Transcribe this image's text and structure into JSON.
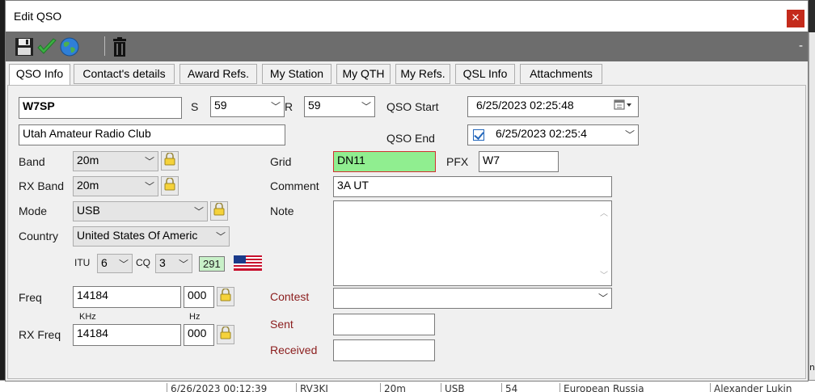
{
  "window": {
    "title": "Edit QSO",
    "close_glyph": "✕"
  },
  "toolbar": {
    "icons": [
      "save-icon",
      "checkmark-icon",
      "globe-icon",
      "trash-icon"
    ],
    "collapse_glyph": "-"
  },
  "tabs": [
    {
      "label": "QSO Info",
      "active": true
    },
    {
      "label": "Contact's details"
    },
    {
      "label": "Award Refs."
    },
    {
      "label": "My Station"
    },
    {
      "label": "My QTH"
    },
    {
      "label": "My Refs."
    },
    {
      "label": "QSL Info"
    },
    {
      "label": "Attachments"
    }
  ],
  "qso": {
    "callsign": "W7SP",
    "s_label": "S",
    "s_value": "59",
    "r_label": "R",
    "r_value": "59",
    "name": "Utah Amateur Radio Club",
    "start_label": "QSO Start",
    "start_value": "6/25/2023 02:25:48",
    "end_label": "QSO End",
    "end_value": "6/25/2023 02:25:4",
    "band_label": "Band",
    "band_value": "20m",
    "rxband_label": "RX Band",
    "rxband_value": "20m",
    "mode_label": "Mode",
    "mode_value": "USB",
    "country_label": "Country",
    "country_value": "United States Of Americ",
    "itu_label": "ITU",
    "itu_value": "6",
    "cq_label": "CQ",
    "cq_value": "3",
    "dxcc_code": "291",
    "grid_label": "Grid",
    "grid_value": "DN11",
    "pfx_label": "PFX",
    "pfx_value": "W7",
    "comment_label": "Comment",
    "comment_value": "3A UT",
    "note_label": "Note",
    "note_value": "",
    "freq_label": "Freq",
    "freq_value": "14184",
    "freq_hz": "000",
    "khz_label": "KHz",
    "hz_label": "Hz",
    "rxfreq_label": "RX Freq",
    "rxfreq_value": "14184",
    "rxfreq_hz": "000",
    "contest_label": "Contest",
    "contest_value": "",
    "sent_label": "Sent",
    "sent_value": "",
    "received_label": "Received",
    "received_value": ""
  },
  "background": {
    "log_row": [
      "6/26/2023 00:12:39",
      "RV3KJ",
      "20m",
      "USB",
      "54",
      "European Russia",
      "Alexander Lukin"
    ],
    "right_edge_text": "n"
  },
  "colors": {
    "grid_ok": "#90ee90",
    "grid_border": "#d03030",
    "close_red": "#c42b1c",
    "toolbar_grey": "#6d6d6d"
  }
}
